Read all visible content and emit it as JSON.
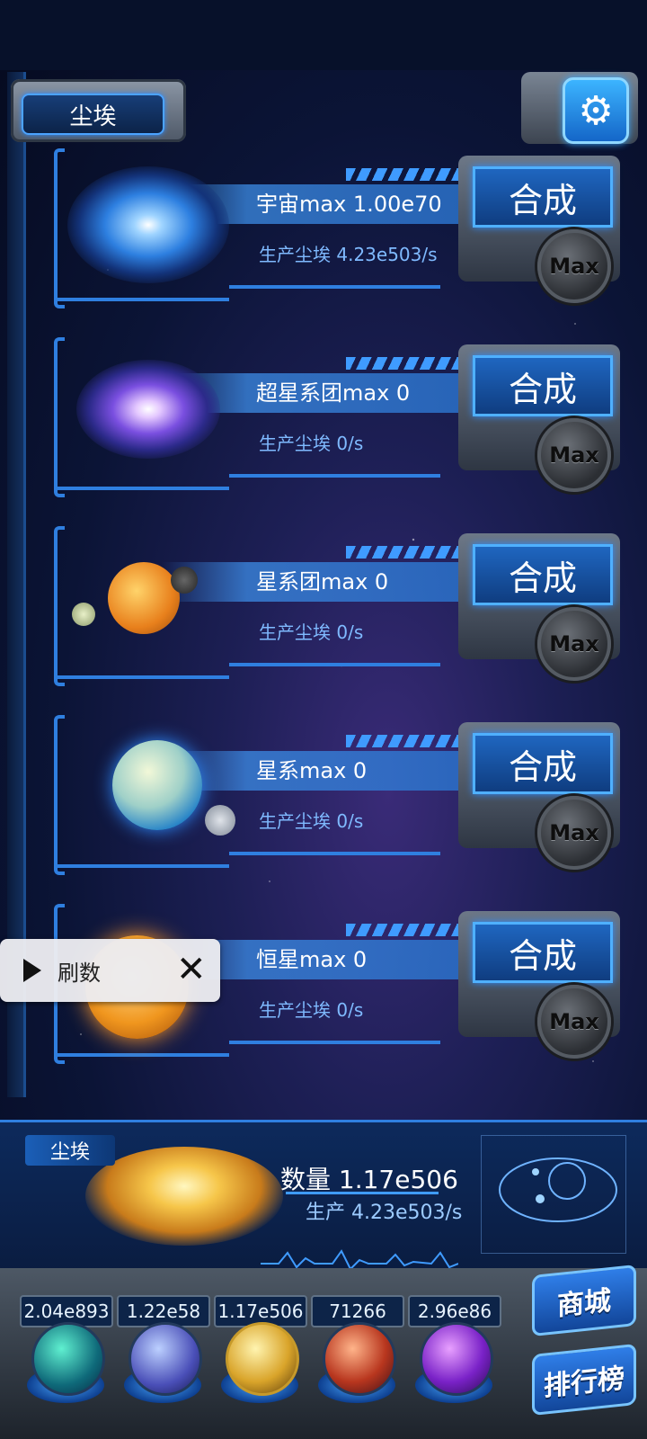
{
  "header": {
    "title": "尘埃"
  },
  "rows": [
    {
      "name": "宇宙max 1.00e70",
      "production": "生产尘埃  4.23e503/s",
      "merge_label": "合成",
      "max_label": "Max"
    },
    {
      "name": "超星系团max 0",
      "production": "生产尘埃  0/s",
      "merge_label": "合成",
      "max_label": "Max"
    },
    {
      "name": "星系团max 0",
      "production": "生产尘埃  0/s",
      "merge_label": "合成",
      "max_label": "Max"
    },
    {
      "name": "星系max 0",
      "production": "生产尘埃  0/s",
      "merge_label": "合成",
      "max_label": "Max"
    },
    {
      "name": "恒星max 0",
      "production": "生产尘埃  0/s",
      "merge_label": "合成",
      "max_label": "Max"
    }
  ],
  "popup": {
    "label": "刷数"
  },
  "dust_panel": {
    "tag": "尘埃",
    "count": "数量 1.17e506",
    "production": "生产 4.23e503/s"
  },
  "resources": [
    "2.04e893",
    "1.22e58",
    "1.17e506",
    "71266",
    "2.96e86"
  ],
  "side_buttons": {
    "shop": "商城",
    "leaderboard": "排行榜"
  },
  "colors": {
    "accent": "#2f7fe0",
    "panel": "#0d2448",
    "frame": "#4d5865"
  }
}
